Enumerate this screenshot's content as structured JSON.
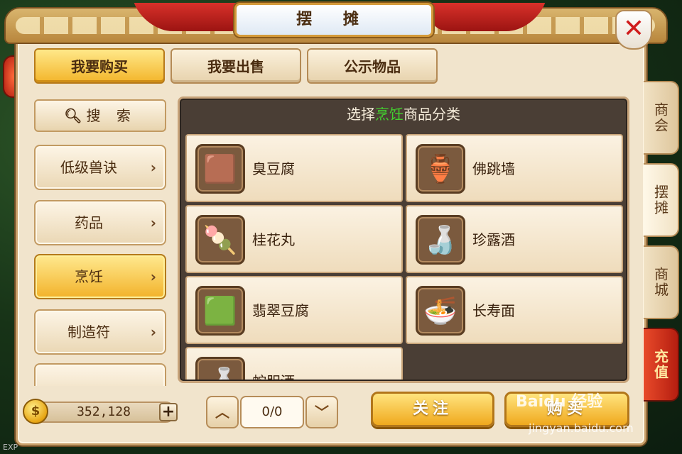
{
  "window": {
    "title": "摆  摊"
  },
  "top_tabs": [
    {
      "label": "我要购买",
      "active": true
    },
    {
      "label": "我要出售",
      "active": false
    },
    {
      "label": "公示物品",
      "active": false
    }
  ],
  "search": {
    "label": "搜 索"
  },
  "categories": [
    {
      "label": "低级兽诀",
      "active": false
    },
    {
      "label": "药品",
      "active": false
    },
    {
      "label": "烹饪",
      "active": true
    },
    {
      "label": "制造符",
      "active": false
    },
    {
      "label": "",
      "active": false
    }
  ],
  "panel": {
    "header_prefix": "选择",
    "header_highlight": "烹饪",
    "header_suffix": "商品分类"
  },
  "items": [
    {
      "name": "臭豆腐",
      "icon": "stinky-tofu-icon",
      "glyph": "🟫"
    },
    {
      "name": "佛跳墙",
      "icon": "jar-soup-icon",
      "glyph": "🏺"
    },
    {
      "name": "桂花丸",
      "icon": "osmanthus-ball-icon",
      "glyph": "🍡"
    },
    {
      "name": "珍露酒",
      "icon": "wine-vessel-icon",
      "glyph": "🍶"
    },
    {
      "name": "翡翠豆腐",
      "icon": "jade-tofu-icon",
      "glyph": "🟩"
    },
    {
      "name": "长寿面",
      "icon": "noodle-bowl-icon",
      "glyph": "🍜"
    },
    {
      "name": "蛇胆酒",
      "icon": "snake-wine-icon",
      "glyph": "🍶"
    }
  ],
  "money": {
    "amount": "352,128"
  },
  "pager": {
    "up": "︿",
    "down": "﹀",
    "value": "0/0"
  },
  "buttons": {
    "follow": "关注",
    "buy": "购买"
  },
  "side_tabs": [
    {
      "label": "商会"
    },
    {
      "label": "摆摊"
    },
    {
      "label": "商城"
    },
    {
      "label": "充值"
    }
  ],
  "watermark": {
    "logo": "Baidu 经验",
    "url": "jingyan.baidu.com"
  },
  "exp_label": "EXP",
  "colors": {
    "highlight_green": "#43d12f",
    "accent_gold": "#f2b22a",
    "panel_dark": "#4a3e35"
  }
}
